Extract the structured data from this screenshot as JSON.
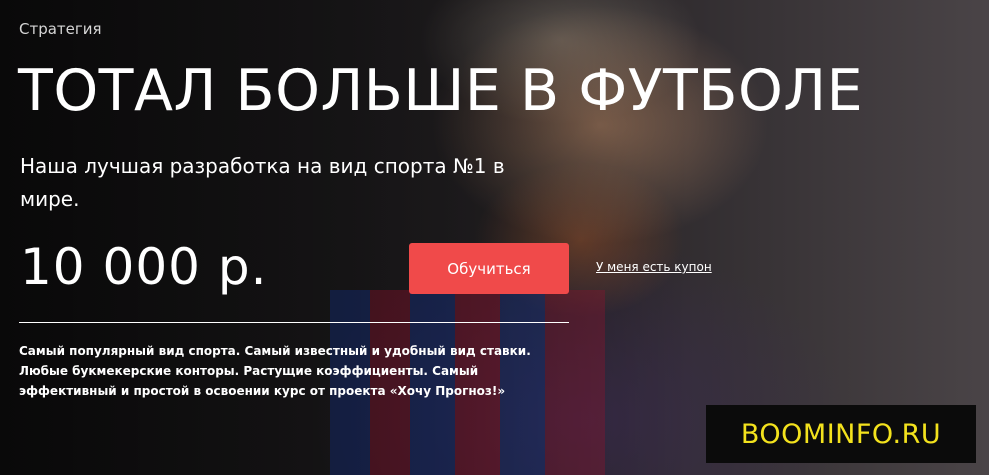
{
  "hero": {
    "category": "Стратегия",
    "title": "ТОТАЛ БОЛЬШЕ В ФУТБОЛЕ",
    "subtitle": "Наша лучшая разработка на вид спорта №1 в мире.",
    "price": "10 000 р.",
    "cta_label": "Обучиться",
    "coupon_link": "У меня есть купон",
    "description": "Самый популярный вид спорта. Самый известный и удобный вид ставки. Любые букмекерские конторы. Растущие коэффициенты. Самый эффективный и простой в освоении курс от проекта «Хочу Прогноз!»"
  },
  "watermark": {
    "text": "BOOMINFO.RU"
  },
  "colors": {
    "accent": "#f04a4a",
    "text": "#ffffff",
    "watermark_text": "#f3e21d",
    "watermark_bg": "#0b0b0b"
  }
}
